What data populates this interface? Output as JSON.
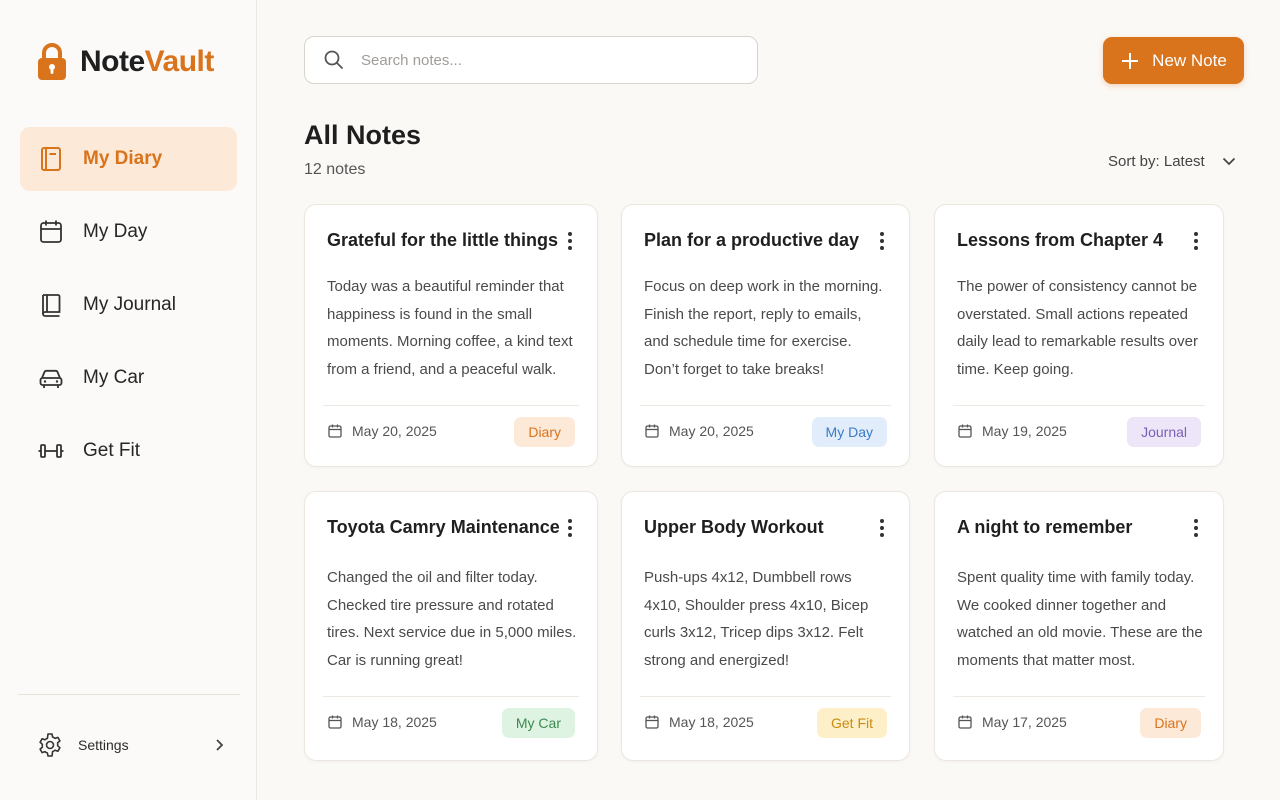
{
  "app": {
    "name_part1": "Note",
    "name_part2": "Vault"
  },
  "sidebar": {
    "items": [
      {
        "label": "My Diary",
        "icon": "book-icon",
        "active": true
      },
      {
        "label": "My Day",
        "icon": "calendar-icon",
        "active": false
      },
      {
        "label": "My Journal",
        "icon": "journal-icon",
        "active": false
      },
      {
        "label": "My Car",
        "icon": "car-icon",
        "active": false
      },
      {
        "label": "Get Fit",
        "icon": "dumbbell-icon",
        "active": false
      }
    ],
    "settings_label": "Settings"
  },
  "search": {
    "placeholder": "Search notes..."
  },
  "toolbar": {
    "new_note_label": "New Note"
  },
  "main": {
    "title": "All Notes",
    "count": "12 notes",
    "sort_label": "Sort by: Latest"
  },
  "notes": [
    {
      "title": "Grateful for the little things",
      "body": "Today was a beautiful reminder that happiness is found in the small moments. Morning coffee, a kind text from a friend, and a peaceful walk.",
      "date": "May 20, 2025",
      "tag": "Diary"
    },
    {
      "title": "Plan for a productive day",
      "body": "Focus on deep work in the morning. Finish the report, reply to emails, and schedule time for exercise. Don’t forget to take breaks!",
      "date": "May 20, 2025",
      "tag": "My Day"
    },
    {
      "title": "Lessons from Chapter 4",
      "body": "The power of consistency cannot be overstated. Small actions repeated daily lead to remarkable results over time. Keep going.",
      "date": "May 19, 2025",
      "tag": "Journal"
    },
    {
      "title": "Toyota Camry Maintenance",
      "body": "Changed the oil and filter today. Checked tire pressure and rotated tires. Next service due in 5,000 miles. Car is running great!",
      "date": "May 18, 2025",
      "tag": "My Car"
    },
    {
      "title": "Upper Body Workout",
      "body": "Push-ups 4x12, Dumbbell rows 4x10, Shoulder press 4x10, Bicep curls 3x12, Tricep dips 3x12. Felt strong and energized!",
      "date": "May 18, 2025",
      "tag": "Get Fit"
    },
    {
      "title": "A night to remember",
      "body": "Spent quality time with family today. We cooked dinner together and watched an old movie. These are the moments that matter most.",
      "date": "May 17, 2025",
      "tag": "Diary"
    }
  ],
  "colors": {
    "accent": "#d9731c",
    "active_bg": "#fde9d8",
    "tag_diary_bg": "#fde9d8",
    "tag_diary_fg": "#d9731c",
    "tag_myday_bg": "#e1edfa",
    "tag_myday_fg": "#3b7bc4",
    "tag_journal_bg": "#ece6f8",
    "tag_journal_fg": "#7a5fb5",
    "tag_mycar_bg": "#dff3e3",
    "tag_mycar_fg": "#3c8a4f",
    "tag_getfit_bg": "#fdf0c8",
    "tag_getfit_fg": "#c98b12"
  }
}
